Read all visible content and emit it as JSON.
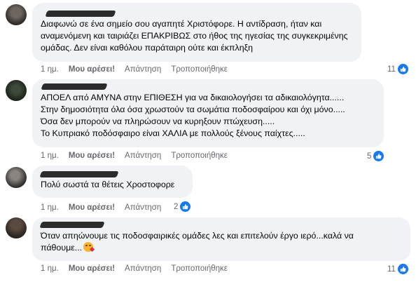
{
  "comments": [
    {
      "lines": [
        "Διαφωνώ σε ένα σημείο σου αγαπητέ Χριστόφορε. Η αντίδραση, ήταν και",
        "αναμενόμενη και ταιριάζει ΕΠΑΚΡΙΒΩΣ στο ήθος της ηγεσίας της συγκεκριμένης",
        "ομάδας. Δεν είναι καθόλου παράταιρη ούτε και έκπληξη"
      ],
      "time": "1 ημ.",
      "like": "Μου αρέσει!",
      "reply": "Απάντηση",
      "edited": "Τροποποιήθηκε",
      "reactions": "11"
    },
    {
      "lines": [
        "ΑΠΟΕΛ από ΑΜΥΝΑ στην ΕΠΙΘΕΣΗ για να δικαιολογήσει τα αδικαιολόγητα......",
        "Στην δημοσιότητα όλα όσα χρωστούν τα σωμάτια ποδοσφαίρου και όχι μόνο.....",
        "Όσα δεν μπορούν να πληρώσουν να κυρηξουν πτώχευση.....",
        "Το Κυπριακό ποδόσφαιρο είναι ΧΑΛΙΑ με πολλούς ξένους παίχτες....."
      ],
      "time": "1 ημ.",
      "like": "Μου αρέσει!",
      "reply": "Απάντηση",
      "edited": "Τροποποιήθηκε",
      "reactions": "5"
    },
    {
      "lines": [
        "Πολύ σωστά τα θέτεις Χροστοφορε"
      ],
      "time": "1 ημ.",
      "like": "Μου αρέσει!",
      "reply": "Απάντηση",
      "reactions": "2"
    },
    {
      "lines": [
        "Όταν απηώνουμε τις ποδοσφαιρικές ομάδες λες και επιτελούν έργο ιερό...καλά να",
        "πάθουμε..."
      ],
      "time": "1 ημ.",
      "like": "Μου αρέσει!",
      "reply": "Απάντηση",
      "edited": "Τροποποιήθηκε",
      "reactions": "11"
    }
  ],
  "icons": {
    "reaction": "like-thumb-icon",
    "emoji": "heart-eyes-emoji-icon"
  },
  "colors": {
    "bubble": "#f0f2f5",
    "like_blue": "#1877f2",
    "meta_gray": "#65676b"
  }
}
